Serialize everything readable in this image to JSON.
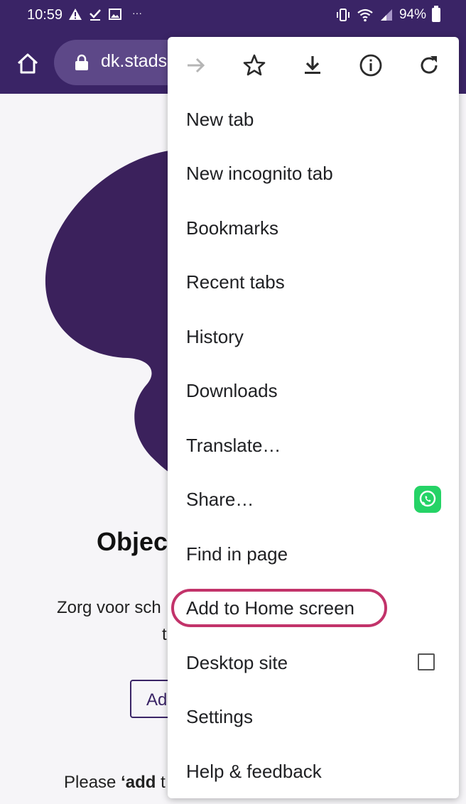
{
  "status_bar": {
    "time": "10:59",
    "left_icons": [
      "warning-icon",
      "check-icon",
      "image-icon"
    ],
    "dots": "···",
    "right_icons": [
      "vibrate-icon",
      "wifi-icon",
      "signal-icon",
      "battery-icon"
    ],
    "battery": "94%"
  },
  "toolbar": {
    "url_text": "dk.stads"
  },
  "page": {
    "heading": "Objec",
    "line1": "Zorg voor sch",
    "line2": "t",
    "button_label": "Ad",
    "line3_prefix": "Please ",
    "line3_bold": "‘add",
    "line3_suffix": " t"
  },
  "menu": {
    "top_icons": [
      "forward-icon",
      "bookmark-star-icon",
      "download-icon",
      "info-icon",
      "refresh-icon"
    ],
    "items": [
      {
        "label": "New tab"
      },
      {
        "label": "New incognito tab"
      },
      {
        "label": "Bookmarks"
      },
      {
        "label": "Recent tabs"
      },
      {
        "label": "History"
      },
      {
        "label": "Downloads"
      },
      {
        "label": "Translate…"
      },
      {
        "label": "Share…"
      },
      {
        "label": "Find in page"
      },
      {
        "label": "Add to Home screen"
      },
      {
        "label": "Desktop site"
      },
      {
        "label": "Settings"
      },
      {
        "label": "Help & feedback"
      }
    ],
    "highlighted_item": "Add to Home screen"
  },
  "colors": {
    "brand_purple": "#3a2466",
    "urlbar": "#5d4888",
    "highlight_ring": "#c2336a",
    "whatsapp_green": "#25d366"
  }
}
